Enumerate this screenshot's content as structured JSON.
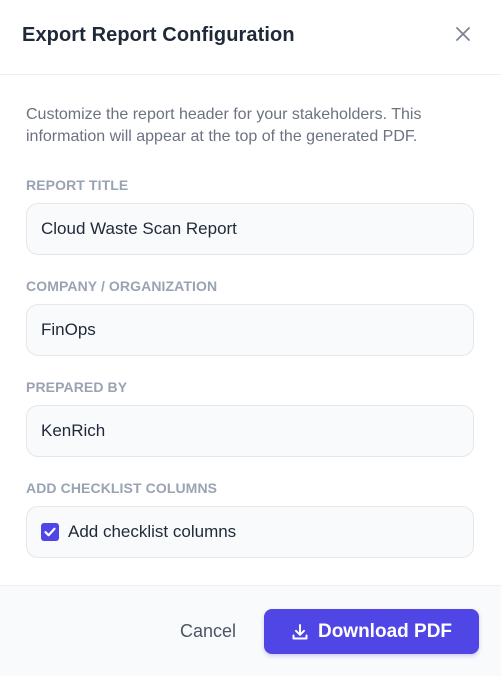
{
  "dialog": {
    "title": "Export Report Configuration",
    "close_icon": "close-icon",
    "description": "Customize the report header for your stakeholders. This information will appear at the top of the generated PDF."
  },
  "fields": {
    "report_title": {
      "label": "REPORT TITLE",
      "value": "Cloud Waste Scan Report"
    },
    "company": {
      "label": "COMPANY / ORGANIZATION",
      "value": "FinOps"
    },
    "prepared_by": {
      "label": "PREPARED BY",
      "value": "KenRich"
    },
    "checklist": {
      "label": "ADD CHECKLIST COLUMNS",
      "checkbox_label": "Add checklist columns",
      "checked": true
    }
  },
  "footer": {
    "cancel_label": "Cancel",
    "download_label": "Download PDF",
    "download_icon": "download-icon"
  },
  "colors": {
    "accent": "#4f46e5",
    "label": "#9aa3b2",
    "text": "#1f2937",
    "muted": "#6b7280"
  }
}
